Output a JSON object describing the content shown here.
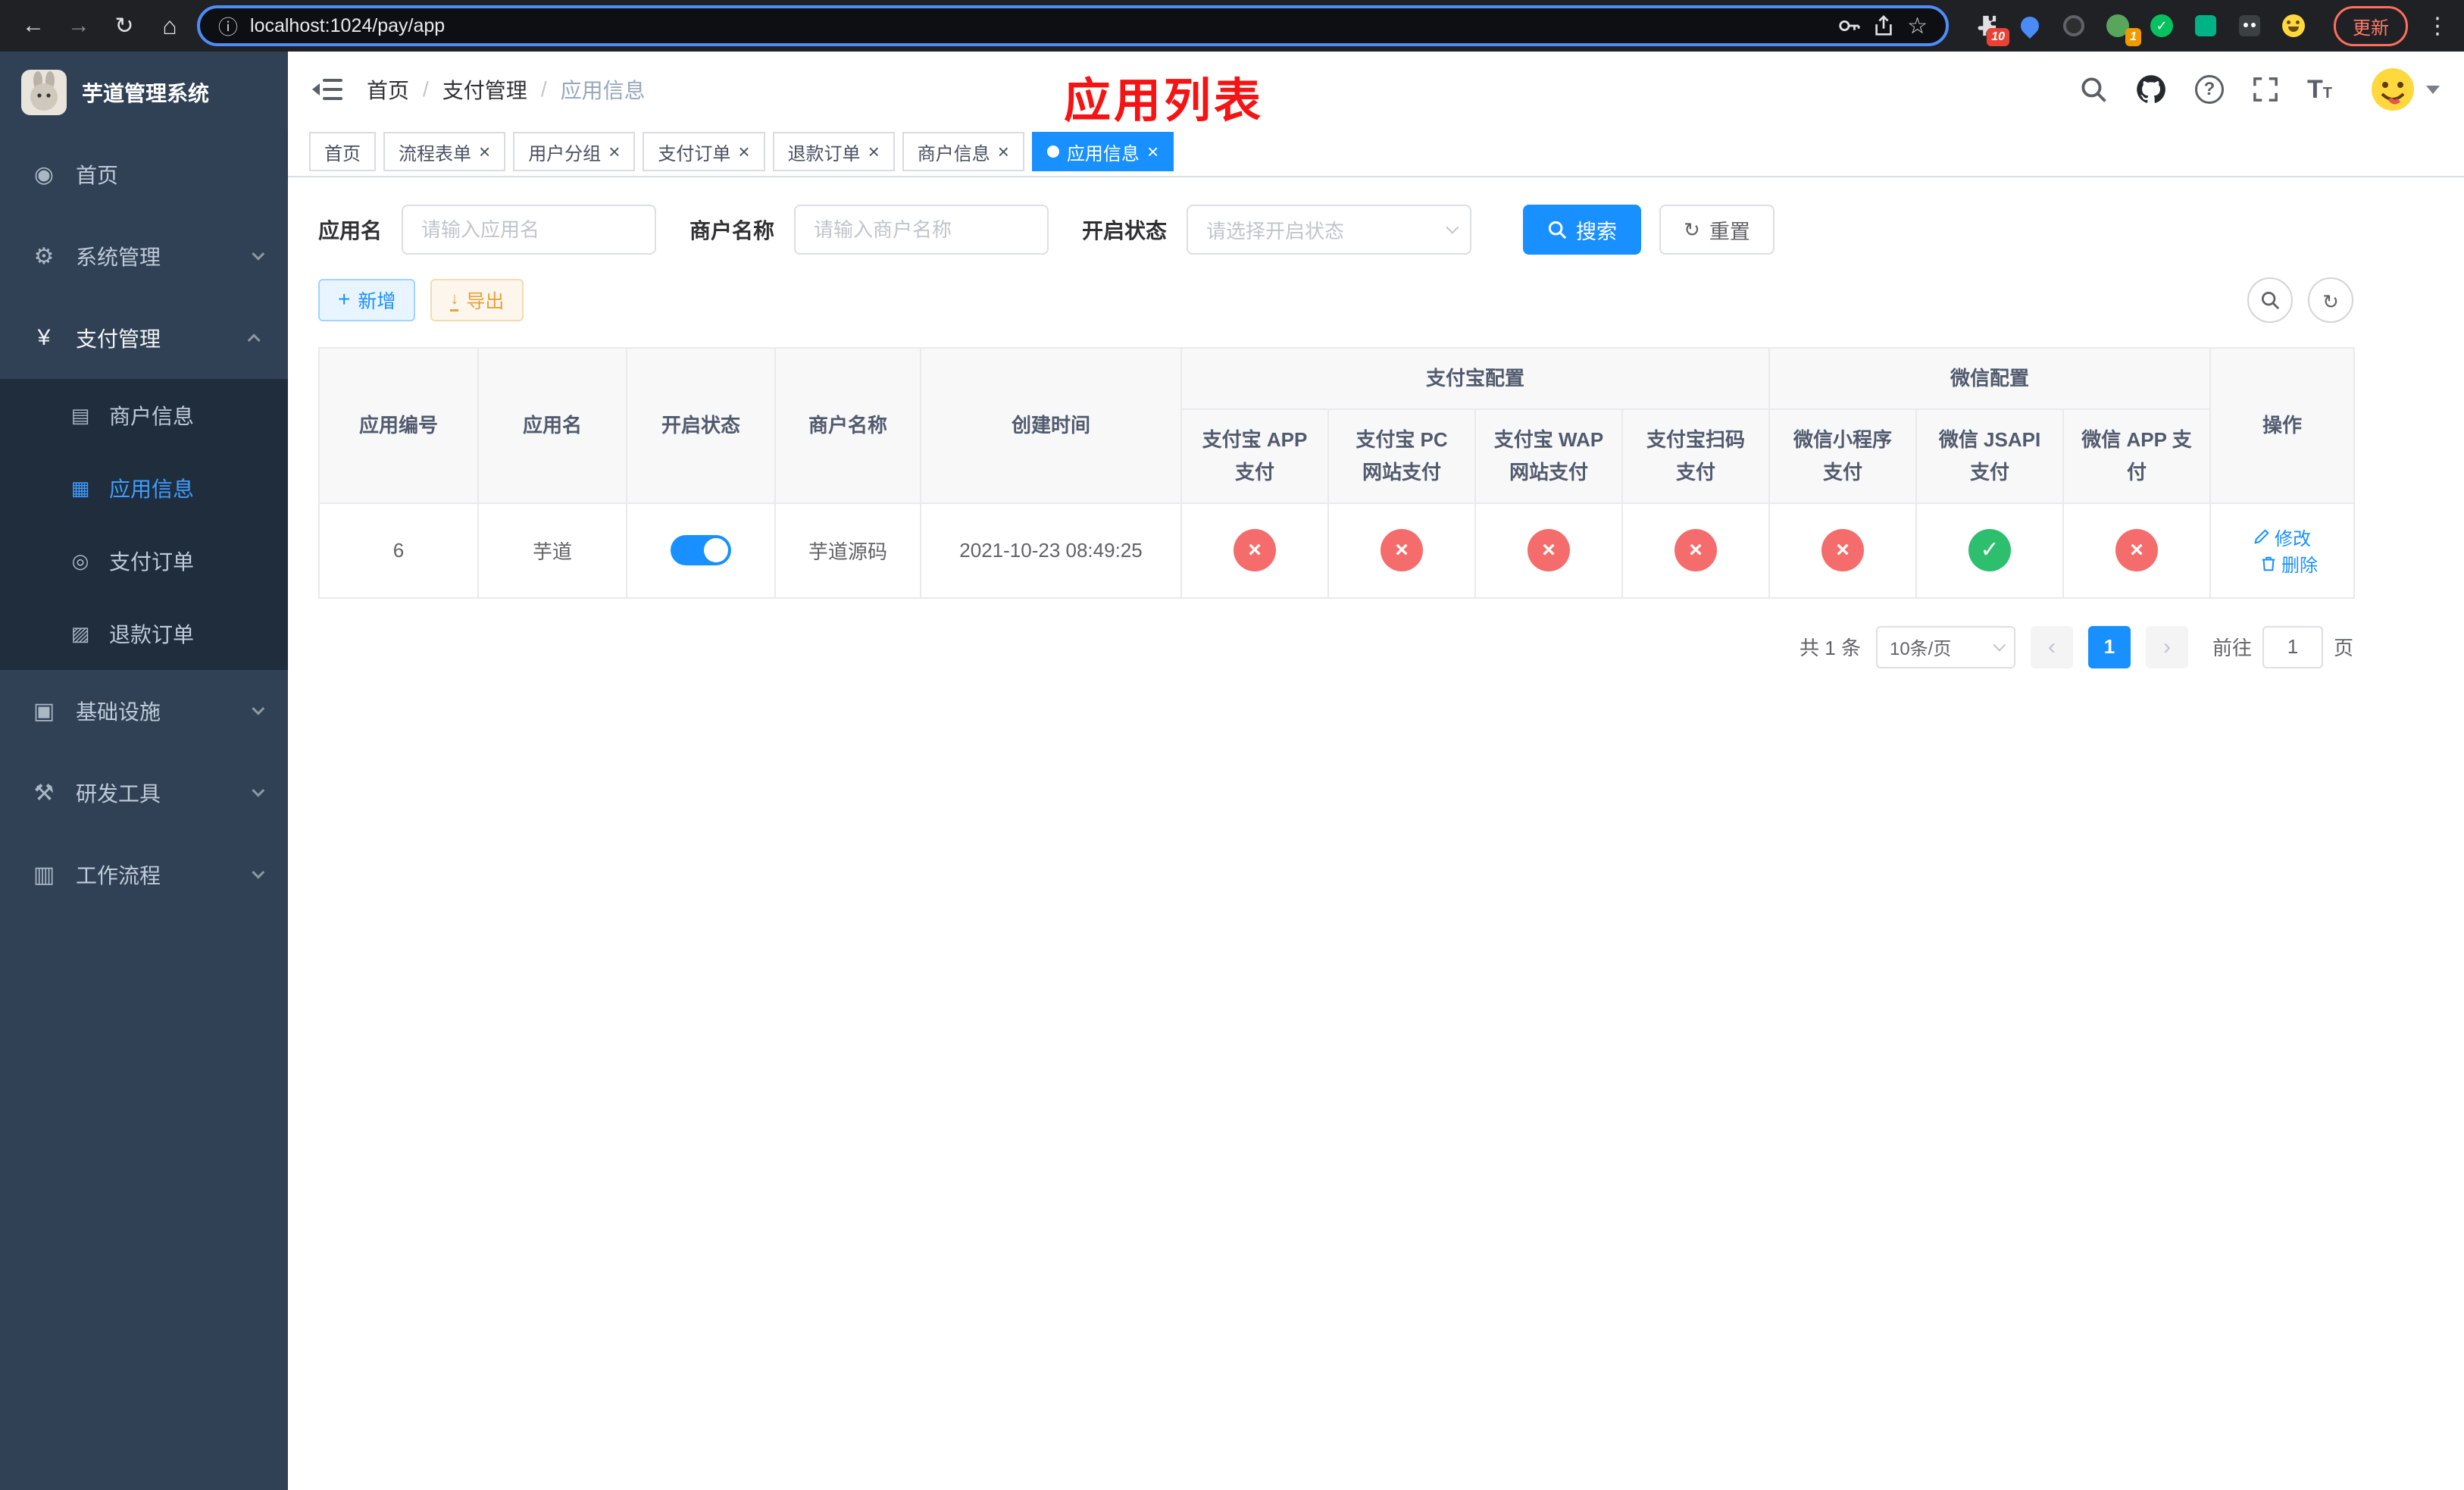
{
  "colors": {
    "primary": "#1890ff",
    "sidebar_active": "#409eff",
    "danger_circle": "#f56c6c",
    "success_circle": "#2dbf6e",
    "warning": "#e6a23c",
    "annotation_red": "#f51313",
    "sidebar_bg": "#304156",
    "submenu_bg": "#1f2d3d"
  },
  "browser": {
    "url": "localhost:1024/pay/app",
    "update_button": "更新",
    "extension_badge_puzzle": "10",
    "extension_badge_avatar": "1"
  },
  "sidebar": {
    "logo_title": "芋道管理系统",
    "items": [
      {
        "label": "首页",
        "icon": "dashboard-icon",
        "glyph": "◉"
      },
      {
        "label": "系统管理",
        "icon": "gear-icon",
        "glyph": "⚙"
      },
      {
        "label": "支付管理",
        "icon": "yen-icon",
        "glyph": "¥"
      },
      {
        "label": "基础设施",
        "icon": "infrastructure-icon",
        "glyph": "▣"
      },
      {
        "label": "研发工具",
        "icon": "tools-icon",
        "glyph": "⚒"
      },
      {
        "label": "工作流程",
        "icon": "workflow-icon",
        "glyph": "▥"
      }
    ],
    "payment_children": [
      {
        "label": "商户信息",
        "icon": "card-icon",
        "glyph": "▤"
      },
      {
        "label": "应用信息",
        "icon": "grid-icon",
        "glyph": "▦",
        "active": true
      },
      {
        "label": "支付订单",
        "icon": "order-icon",
        "glyph": "◎"
      },
      {
        "label": "退款订单",
        "icon": "refund-icon",
        "glyph": "▨"
      }
    ]
  },
  "header": {
    "breadcrumb": {
      "items": [
        "首页",
        "支付管理",
        "应用信息"
      ],
      "separator": "/"
    },
    "page_annotation": "应用列表"
  },
  "tabs": [
    {
      "label": "首页",
      "closable": false,
      "active": false
    },
    {
      "label": "流程表单",
      "closable": true,
      "active": false
    },
    {
      "label": "用户分组",
      "closable": true,
      "active": false
    },
    {
      "label": "支付订单",
      "closable": true,
      "active": false
    },
    {
      "label": "退款订单",
      "closable": true,
      "active": false
    },
    {
      "label": "商户信息",
      "closable": true,
      "active": false
    },
    {
      "label": "应用信息",
      "closable": true,
      "active": true
    }
  ],
  "filters": {
    "app_name_label": "应用名",
    "app_name_placeholder": "请输入应用名",
    "app_name_value": "",
    "merchant_label": "商户名称",
    "merchant_placeholder": "请输入商户名称",
    "merchant_value": "",
    "status_label": "开启状态",
    "status_placeholder": "请选择开启状态",
    "search_label": "搜索",
    "reset_label": "重置"
  },
  "toolbar": {
    "add_label": "新增",
    "export_label": "导出"
  },
  "table": {
    "group_alipay": "支付宝配置",
    "group_wechat": "微信配置",
    "columns": {
      "app_id": "应用编号",
      "app_name": "应用名",
      "status": "开启状态",
      "merchant": "商户名称",
      "created": "创建时间",
      "alipay_app": "支付宝 APP 支付",
      "alipay_pc": "支付宝 PC 网站支付",
      "alipay_wap": "支付宝 WAP 网站支付",
      "alipay_qr": "支付宝扫码支付",
      "wx_mini": "微信小程序支付",
      "wx_jsapi": "微信 JSAPI 支付",
      "wx_app": "微信 APP 支付",
      "actions": "操作"
    },
    "rows": [
      {
        "app_id": "6",
        "app_name": "芋道",
        "status_enabled": true,
        "merchant": "芋道源码",
        "created": "2021-10-23 08:49:25",
        "alipay_app": false,
        "alipay_pc": false,
        "alipay_wap": false,
        "alipay_qr": false,
        "wx_mini": false,
        "wx_jsapi": true,
        "wx_app": false,
        "edit_label": "修改",
        "delete_label": "删除"
      }
    ]
  },
  "pagination": {
    "total_text": "共 1 条",
    "page_size": "10条/页",
    "current_page": "1",
    "goto_label": "前往",
    "goto_value": "1",
    "goto_unit": "页"
  }
}
